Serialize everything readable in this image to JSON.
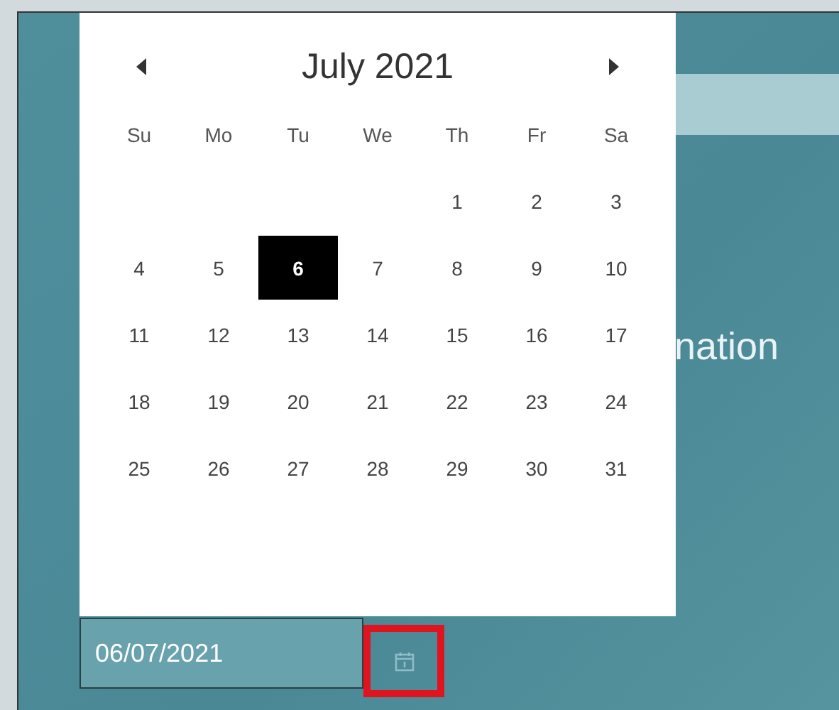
{
  "background": {
    "heading": "nation"
  },
  "date_field": {
    "value": "06/07/2021"
  },
  "calendar_button": {
    "highlighted": true
  },
  "calendar": {
    "month_label": "July 2021",
    "weekdays": [
      "Su",
      "Mo",
      "Tu",
      "We",
      "Th",
      "Fr",
      "Sa"
    ],
    "weeks": [
      [
        {
          "day": "1",
          "selected": false
        },
        {
          "day": "2",
          "selected": false
        },
        {
          "day": "3",
          "selected": false
        }
      ],
      [
        {
          "day": "4",
          "selected": false
        },
        {
          "day": "5",
          "selected": false
        },
        {
          "day": "6",
          "selected": true
        },
        {
          "day": "7",
          "selected": false
        },
        {
          "day": "8",
          "selected": false
        },
        {
          "day": "9",
          "selected": false
        },
        {
          "day": "10",
          "selected": false
        }
      ],
      [
        {
          "day": "11",
          "selected": false
        },
        {
          "day": "12",
          "selected": false
        },
        {
          "day": "13",
          "selected": false
        },
        {
          "day": "14",
          "selected": false
        },
        {
          "day": "15",
          "selected": false
        },
        {
          "day": "16",
          "selected": false
        },
        {
          "day": "17",
          "selected": false
        }
      ],
      [
        {
          "day": "18",
          "selected": false
        },
        {
          "day": "19",
          "selected": false
        },
        {
          "day": "20",
          "selected": false
        },
        {
          "day": "21",
          "selected": false
        },
        {
          "day": "22",
          "selected": false
        },
        {
          "day": "23",
          "selected": false
        },
        {
          "day": "24",
          "selected": false
        }
      ],
      [
        {
          "day": "25",
          "selected": false
        },
        {
          "day": "26",
          "selected": false
        },
        {
          "day": "27",
          "selected": false
        },
        {
          "day": "28",
          "selected": false
        },
        {
          "day": "29",
          "selected": false
        },
        {
          "day": "30",
          "selected": false
        },
        {
          "day": "31",
          "selected": false
        }
      ]
    ]
  }
}
